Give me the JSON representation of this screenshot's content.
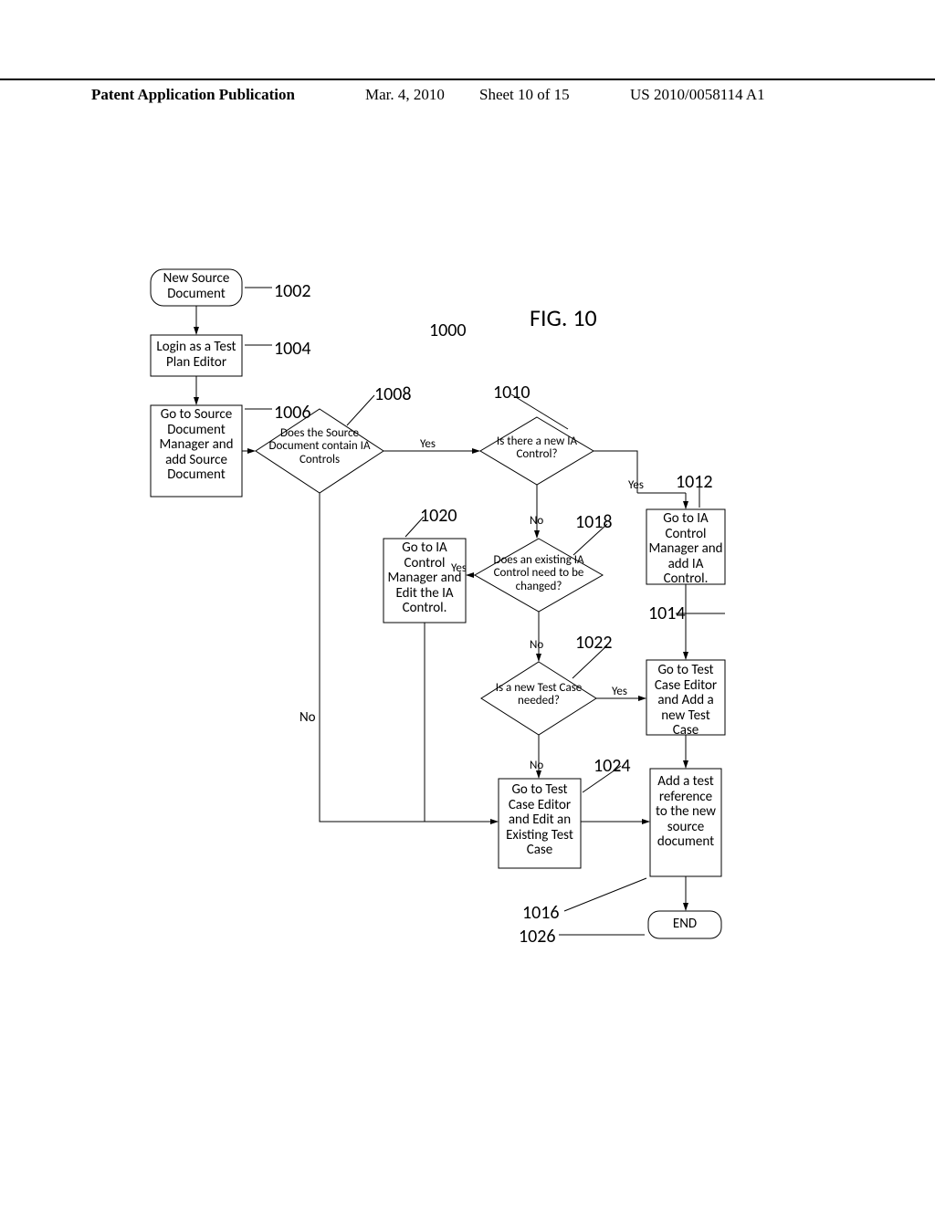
{
  "header": {
    "label": "Patent Application Publication",
    "date": "Mar. 4, 2010",
    "sheet": "Sheet 10 of 15",
    "number": "US 2010/0058114 A1"
  },
  "figure": {
    "title": "FIG. 10",
    "main_ref": "1000",
    "nodes": {
      "n1002": {
        "text": "New Source Document",
        "ref": "1002"
      },
      "n1004": {
        "text": "Login as a Test Plan Editor",
        "ref": "1004"
      },
      "n1006": {
        "text": "Go to Source Document Manager and add Source Document",
        "ref": "1006"
      },
      "n1008": {
        "text": "Does the Source Document contain IA Controls",
        "ref": "1008"
      },
      "n1010": {
        "text": "Is there a new IA Control?",
        "ref": "1010"
      },
      "n1012": {
        "text": "Go to IA Control Manager and add IA Control.",
        "ref": "1012"
      },
      "n1014": {
        "text": "Go to Test Case Editor and Add a new Test Case",
        "ref": "1014"
      },
      "n1016": {
        "text": "Add a test reference to the new source document",
        "ref": "1016"
      },
      "n1018": {
        "text": "Does an existing IA Control need to be changed?",
        "ref": "1018"
      },
      "n1020": {
        "text": "Go to IA Control Manager and Edit the IA Control.",
        "ref": "1020"
      },
      "n1022": {
        "text": "Is a new Test Case needed?",
        "ref": "1022"
      },
      "n1024": {
        "text": "Go to Test Case Editor and Edit an Existing Test Case",
        "ref": "1024"
      },
      "n1026": {
        "text": "END",
        "ref": "1026"
      }
    },
    "edges": {
      "yes": "Yes",
      "no": "No"
    }
  }
}
